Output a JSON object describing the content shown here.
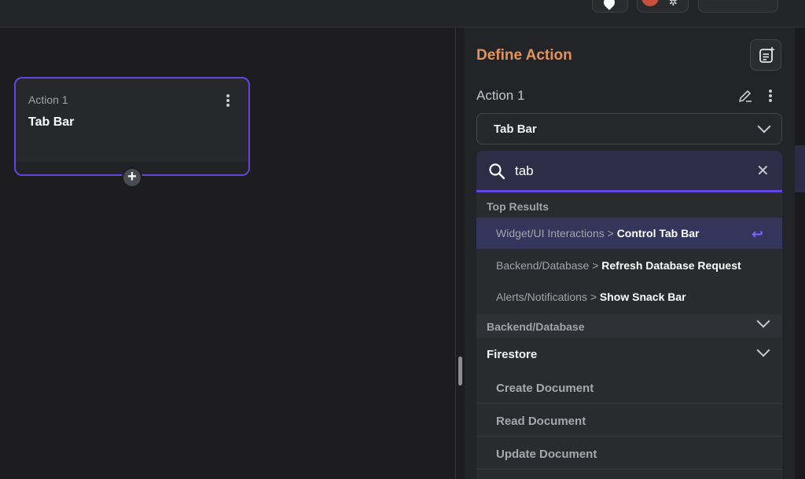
{
  "canvas": {
    "action_card": {
      "label": "Action 1",
      "title": "Tab Bar"
    },
    "add_node_symbol": "+"
  },
  "panel": {
    "title": "Define Action",
    "action_name": "Action 1",
    "selected_action": "Tab Bar",
    "search": {
      "value": "tab",
      "placeholder": ""
    },
    "top_results_label": "Top Results",
    "top_results": [
      {
        "category": "Widget/UI Interactions >",
        "name": "Control Tab Bar",
        "highlighted": true
      },
      {
        "category": "Backend/Database >",
        "name": "Refresh Database Request",
        "highlighted": false
      },
      {
        "category": "Alerts/Notifications >",
        "name": "Show Snack Bar",
        "highlighted": false
      }
    ],
    "group_label": "Backend/Database",
    "subgroup_label": "Firestore",
    "subgroup_items": [
      "Create Document",
      "Read Document",
      "Update Document"
    ]
  },
  "colors": {
    "accent": "#6446dc",
    "title_orange": "#e1935e",
    "record_red": "#c8503f"
  },
  "icons": [
    "location-pin-icon",
    "bug-icon",
    "notes-add-icon",
    "pencil-icon",
    "more-vert-icon",
    "chevron-down-icon",
    "search-icon",
    "close-icon",
    "enter-key-icon",
    "plus-icon"
  ]
}
